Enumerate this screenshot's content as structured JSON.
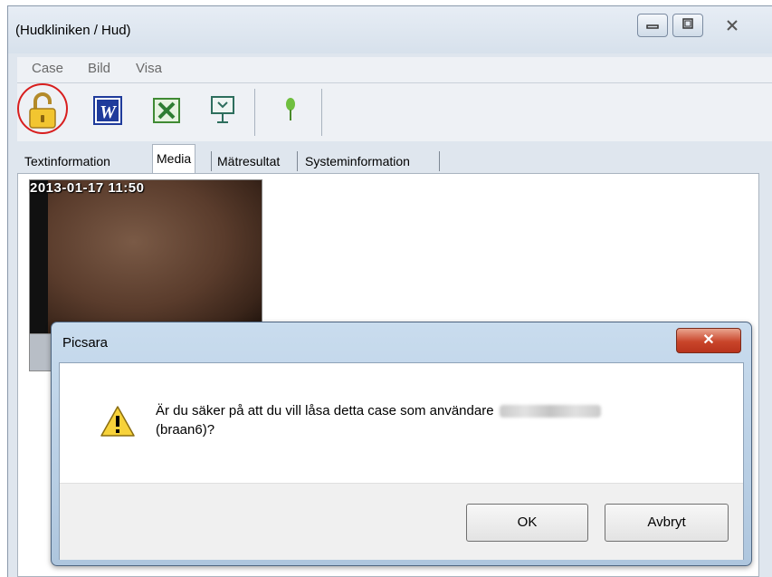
{
  "window": {
    "title": "(Hudkliniken / Hud)"
  },
  "menu": {
    "items": [
      "Case",
      "Bild",
      "Visa"
    ]
  },
  "toolbar": {
    "buttons": [
      "lock-icon",
      "word-icon",
      "excel-icon",
      "presentation-icon",
      "pin-icon"
    ]
  },
  "tabs": [
    "Textinformation",
    "Media",
    "Mätresultat",
    "Systeminformation"
  ],
  "media": {
    "timestamp": "2013-01-17 11:50"
  },
  "dialog": {
    "title": "Picsara",
    "close_label": "✕",
    "message_line1": "Är du säker på att du vill låsa detta case som användare",
    "message_line2": "(braan6)?",
    "ok_label": "OK",
    "cancel_label": "Avbryt"
  },
  "colors": {
    "highlight_circle": "#d81e1e",
    "dialog_close": "#c9452a"
  }
}
